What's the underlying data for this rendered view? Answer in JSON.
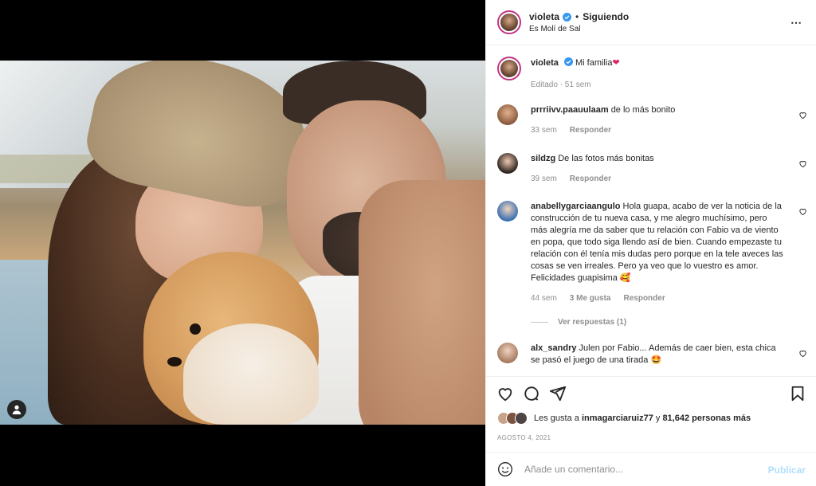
{
  "post": {
    "username": "violeta",
    "separator": "•",
    "following_label": "Siguiendo",
    "location": "Es Molí de Sal",
    "caption": "Mi familia",
    "caption_emoji": "❤",
    "edited_label": "Editado · 51 sem"
  },
  "comments": [
    {
      "user": "prrriivv.paauulaam",
      "text": "de lo más bonito",
      "time": "33 sem",
      "reply": "Responder"
    },
    {
      "user": "sildzg",
      "text": "De las fotos más bonitas",
      "time": "39 sem",
      "reply": "Responder"
    },
    {
      "user": "anabellygarciaangulo",
      "text": "Hola guapa, acabo de ver la noticia de la construcción de tu nueva casa, y me alegro muchísimo, pero más alegría me da saber que tu relación con Fabio va de viento en popa, que todo siga llendo así de bien. Cuando empezaste tu relación con él tenía mis dudas pero porque en la tele aveces las cosas se ven irreales. Pero ya veo que lo vuestro es amor. Felicidades guapisima 🥰",
      "time": "44 sem",
      "likes": "3 Me gusta",
      "reply": "Responder",
      "view_replies": "Ver respuestas (1)"
    },
    {
      "user": "alx_sandry",
      "text": "Julen por Fabio... Además de caer bien, esta chica se pasó el juego de una tirada 🤩",
      "time": "",
      "reply": ""
    }
  ],
  "likes": {
    "prefix": "Les gusta a",
    "user": "inmagarciaruiz77",
    "middle": "y",
    "count": "81,642 personas más"
  },
  "date": "AGOSTO 4, 2021",
  "add_comment": {
    "placeholder": "Añade un comentario...",
    "publish_label": "Publicar"
  },
  "icons": {
    "more": "⋯",
    "heart": "heart-icon",
    "comment": "comment-icon",
    "share": "share-icon",
    "save": "bookmark-icon",
    "emoji": "emoji-icon"
  },
  "colors": {
    "verified": "#3897f0",
    "publish": "#b2dffc",
    "story_ring": "#c13584"
  }
}
